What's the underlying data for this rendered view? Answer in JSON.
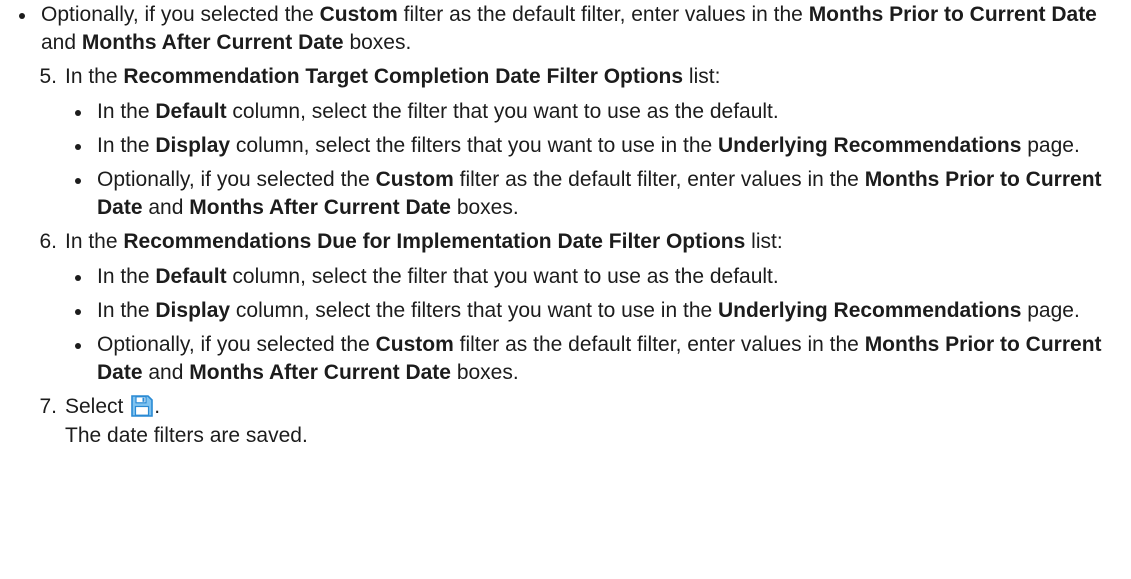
{
  "intro_bullets": [
    {
      "t1": "Optionally, if you selected the ",
      "b1": "Custom",
      "t2": " filter as the default filter, enter values in the ",
      "b2": "Months Prior to Current Date",
      "t3": " and ",
      "b3": "Months After Current Date",
      "t4": " boxes."
    }
  ],
  "steps": [
    {
      "number": "5.",
      "lead": "In the ",
      "bold": "Recommendation Target Completion Date Filter Options",
      "tail": " list:",
      "bullets": {
        "default": {
          "t1": "In the ",
          "b1": "Default",
          "t2": " column, select the filter that you want to use as the default."
        },
        "display": {
          "t1": "In the ",
          "b1": "Display",
          "t2": " column, select the filters that you want to use in the ",
          "b2": "Underlying Recommendations",
          "t3": " page."
        },
        "custom": {
          "t1": "Optionally, if you selected the ",
          "b1": "Custom",
          "t2": " filter as the default filter, enter values in the ",
          "b2": "Months Prior to Current Date",
          "t3": " and ",
          "b3": "Months After Current Date",
          "t4": " boxes."
        }
      }
    },
    {
      "number": "6.",
      "lead": "In the ",
      "bold": "Recommendations Due for Implementation Date Filter Options",
      "tail": " list:",
      "bullets": {
        "default": {
          "t1": "In the ",
          "b1": "Default",
          "t2": " column, select the filter that you want to use as the default."
        },
        "display": {
          "t1": "In the ",
          "b1": "Display",
          "t2": " column, select the filters that you want to use in the ",
          "b2": "Underlying Recommendations",
          "t3": " page."
        },
        "custom": {
          "t1": "Optionally, if you selected the ",
          "b1": "Custom",
          "t2": " filter as the default filter, enter values in the ",
          "b2": "Months Prior to Current Date",
          "t3": " and ",
          "b3": "Months After Current Date",
          "t4": " boxes."
        }
      }
    },
    {
      "number": "7.",
      "lead": "Select ",
      "icon": "save-icon",
      "tail": ".",
      "result": "The date filters are saved."
    }
  ],
  "colors": {
    "text": "#1c1c1c",
    "icon_fill": "#7fc3f0",
    "icon_stroke": "#2a8ad4"
  }
}
